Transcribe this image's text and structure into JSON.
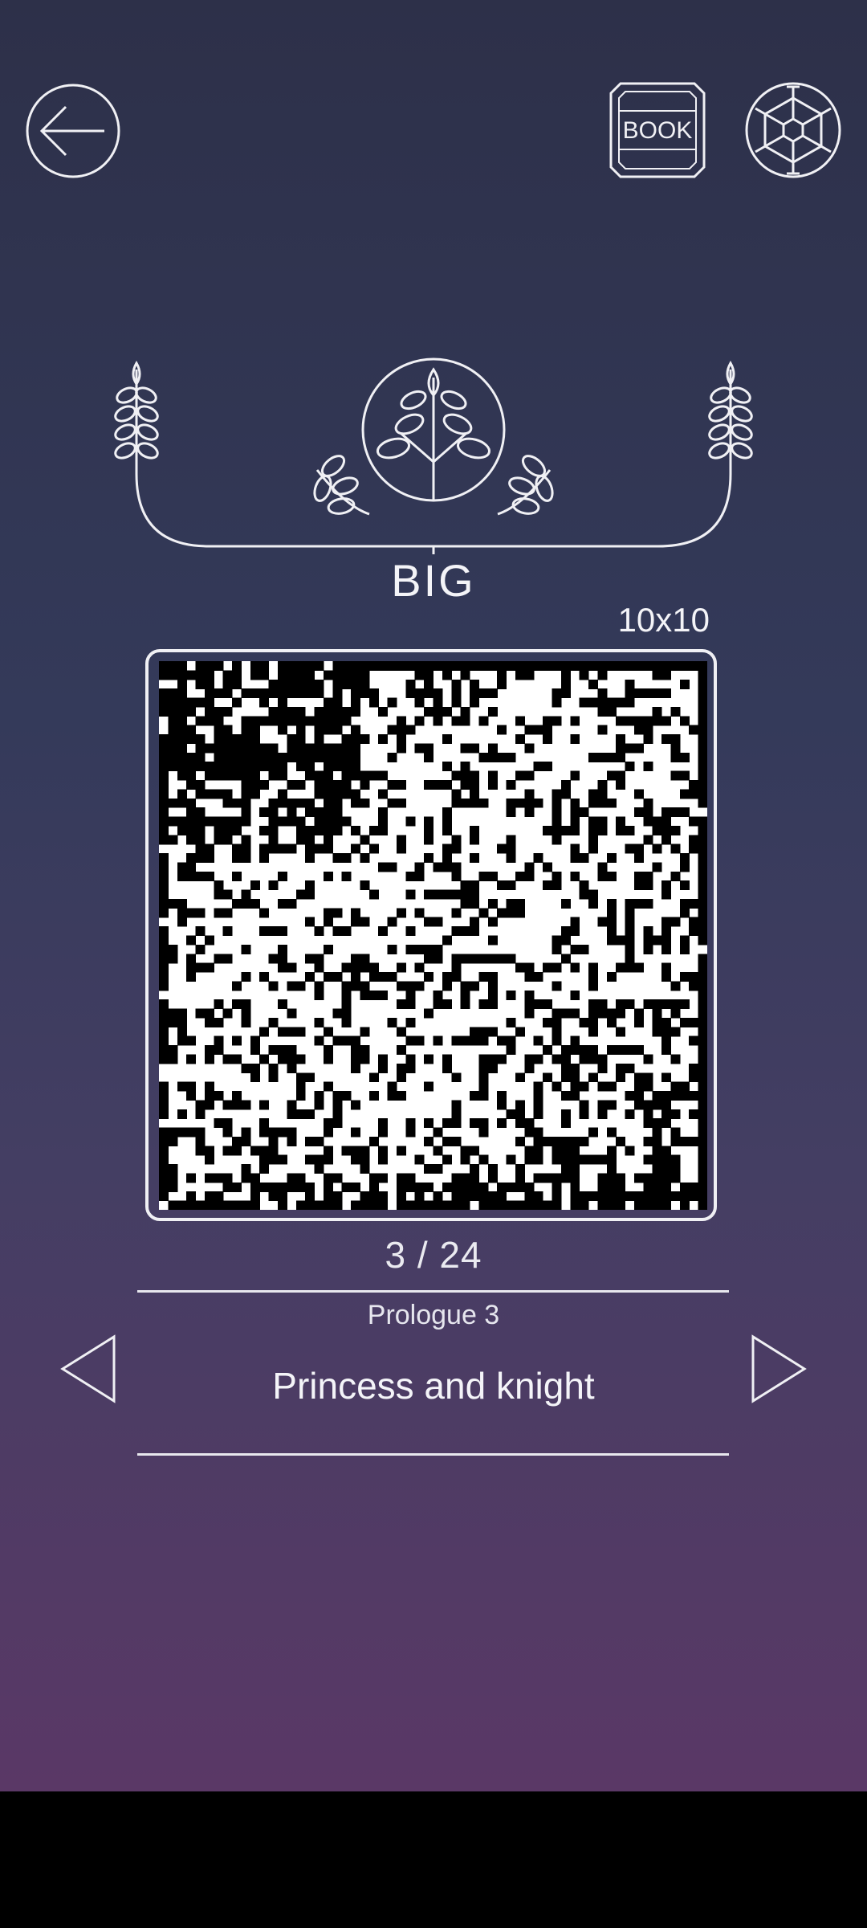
{
  "header": {
    "back_icon": "arrow-left-icon",
    "book_label": "BOOK",
    "settings_icon": "hex-gear-icon"
  },
  "emblem_icon": "laurel-tree-emblem",
  "tier": {
    "label": "BIG",
    "size": "10x10"
  },
  "puzzle": {
    "image": "pixel-art-castle-night-scene",
    "progress": "3 / 24"
  },
  "stage": {
    "chapter": "Prologue 3",
    "title": "Princess and knight",
    "prev_icon": "triangle-left-icon",
    "next_icon": "triangle-right-icon"
  },
  "colors": {
    "bg_top": "#2d3049",
    "bg_bottom": "#5a3866",
    "line": "#f0f0f4"
  }
}
